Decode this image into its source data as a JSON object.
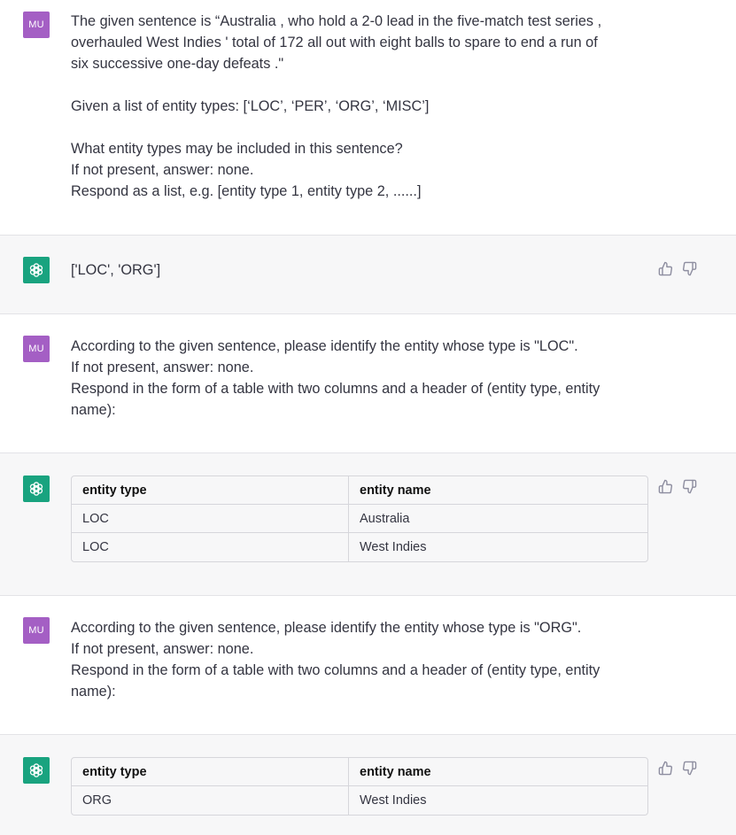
{
  "conversation": {
    "user_avatar_label": "MU",
    "messages": [
      {
        "role": "user",
        "lines": [
          "The given sentence is “Australia , who hold a 2-0 lead in the five-match test series ,",
          "overhauled West Indies ' total of 172 all out with eight balls to spare to end a run of",
          "six successive one-day defeats .\"",
          "",
          "Given a list of entity types: [‘LOC’, ‘PER’, ‘ORG’, ‘MISC’]",
          "",
          "What entity types may be included in this sentence?",
          "If not present, answer: none.",
          "Respond as a list, e.g. [entity type 1, entity type 2, ......]"
        ]
      },
      {
        "role": "assistant",
        "text": "['LOC', 'ORG']"
      },
      {
        "role": "user",
        "lines": [
          "According to the given sentence, please identify the entity whose type is \"LOC\".",
          "If not present, answer: none.",
          "Respond in the form of a table with two columns and a header of (entity type, entity",
          "name):"
        ]
      },
      {
        "role": "assistant",
        "table": {
          "headers": [
            "entity type",
            "entity name"
          ],
          "rows": [
            [
              "LOC",
              "Australia"
            ],
            [
              "LOC",
              "West Indies"
            ]
          ]
        }
      },
      {
        "role": "user",
        "lines": [
          "According to the given sentence, please identify the entity whose type is \"ORG\".",
          "If not present, answer: none.",
          "Respond in the form of a table with two columns and a header of (entity type, entity",
          "name):"
        ]
      },
      {
        "role": "assistant",
        "table": {
          "headers": [
            "entity type",
            "entity name"
          ],
          "rows": [
            [
              "ORG",
              "West Indies"
            ]
          ]
        }
      }
    ]
  },
  "icons": {
    "user_avatar": "user-initials-avatar",
    "assistant_avatar": "openai-logo-icon",
    "thumbs_up": "thumbs-up-icon",
    "thumbs_down": "thumbs-down-icon"
  },
  "colors": {
    "user_avatar_bg": "#a45fc4",
    "assistant_avatar_bg": "#19a37f",
    "assistant_row_bg": "#f7f7f8"
  }
}
